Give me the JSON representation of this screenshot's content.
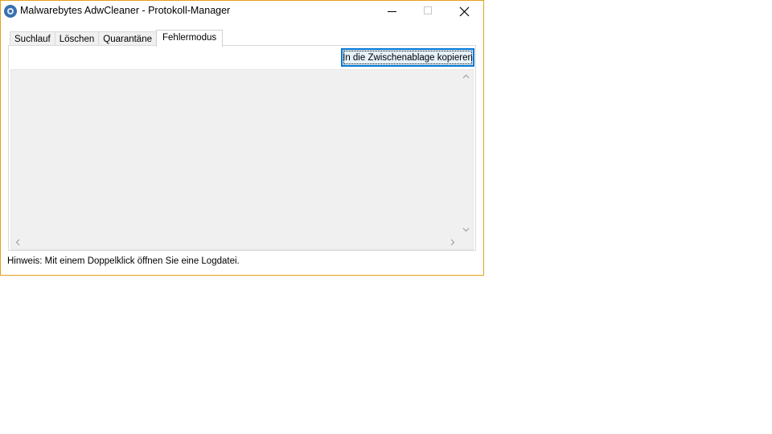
{
  "window": {
    "title": "Malwarebytes AdwCleaner - Protokoll-Manager",
    "accent_border_color": "#e3a21a"
  },
  "titlebar_controls": {
    "minimize_icon": "minimize-icon",
    "maximize_icon": "maximize-icon",
    "close_icon": "close-icon"
  },
  "tabs": [
    {
      "label": "Suchlauf",
      "active": false
    },
    {
      "label": "Löschen",
      "active": false
    },
    {
      "label": "Quarantäne",
      "active": false
    },
    {
      "label": "Fehlermodus",
      "active": true
    }
  ],
  "panel": {
    "copy_button_label": "In die Zwischenablage kopieren"
  },
  "status": {
    "hint": "Hinweis: Mit einem Doppelklick öffnen Sie eine Logdatei."
  }
}
